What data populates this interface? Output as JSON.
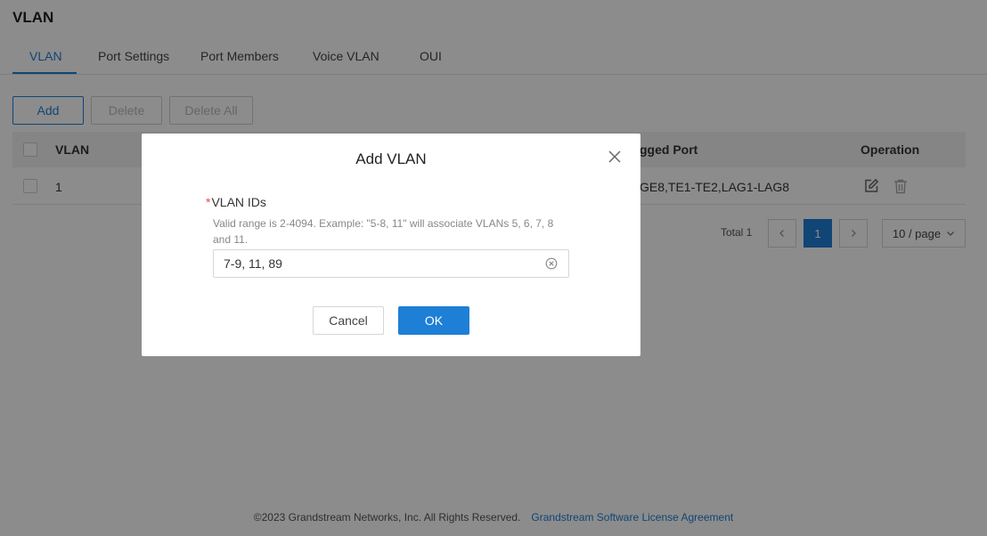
{
  "page": {
    "title": "VLAN"
  },
  "tabs": [
    {
      "label": "VLAN",
      "active": true
    },
    {
      "label": "Port Settings"
    },
    {
      "label": "Port Members"
    },
    {
      "label": "Voice VLAN"
    },
    {
      "label": "OUI"
    }
  ],
  "toolbar": {
    "add_label": "Add",
    "delete_label": "Delete",
    "delete_all_label": "Delete All"
  },
  "table": {
    "columns": {
      "vlan": "VLAN",
      "tagged_port": "gged Port",
      "operation": "Operation"
    },
    "rows": [
      {
        "vlan": "1",
        "tagged_port": "GE8,TE1-TE2,LAG1-LAG8"
      }
    ]
  },
  "pagination": {
    "total": "Total 1",
    "current_page": "1",
    "page_size": "10 / page"
  },
  "footer": {
    "copyright": "©2023 Grandstream Networks, Inc. All Rights Reserved.",
    "license_link": "Grandstream Software License Agreement"
  },
  "modal": {
    "title": "Add VLAN",
    "field_required_mark": "*",
    "field_label": "VLAN IDs",
    "field_help": "Valid range is 2-4094. Example: \"5-8, 11\" will associate VLANs 5, 6, 7, 8 and 11.",
    "field_value": "7-9, 11, 89",
    "cancel_label": "Cancel",
    "ok_label": "OK"
  },
  "colors": {
    "accent": "#1e7fd6",
    "required": "#e84a4a",
    "mask": "rgba(0,0,0,0.45)"
  }
}
